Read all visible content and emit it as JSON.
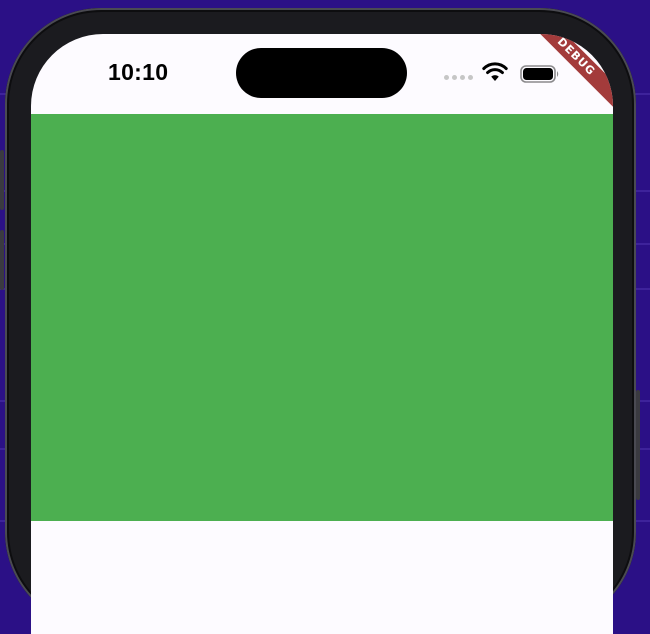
{
  "status_bar": {
    "time": "10:10",
    "wifi_icon": "wifi-icon",
    "battery_icon": "battery-icon"
  },
  "debug_banner": {
    "label": "DEBUG",
    "color": "#a33b3b"
  },
  "content": {
    "box_color": "#4caf50",
    "background_color": "#fdfbff"
  },
  "desktop_background_color": "#2b1086"
}
